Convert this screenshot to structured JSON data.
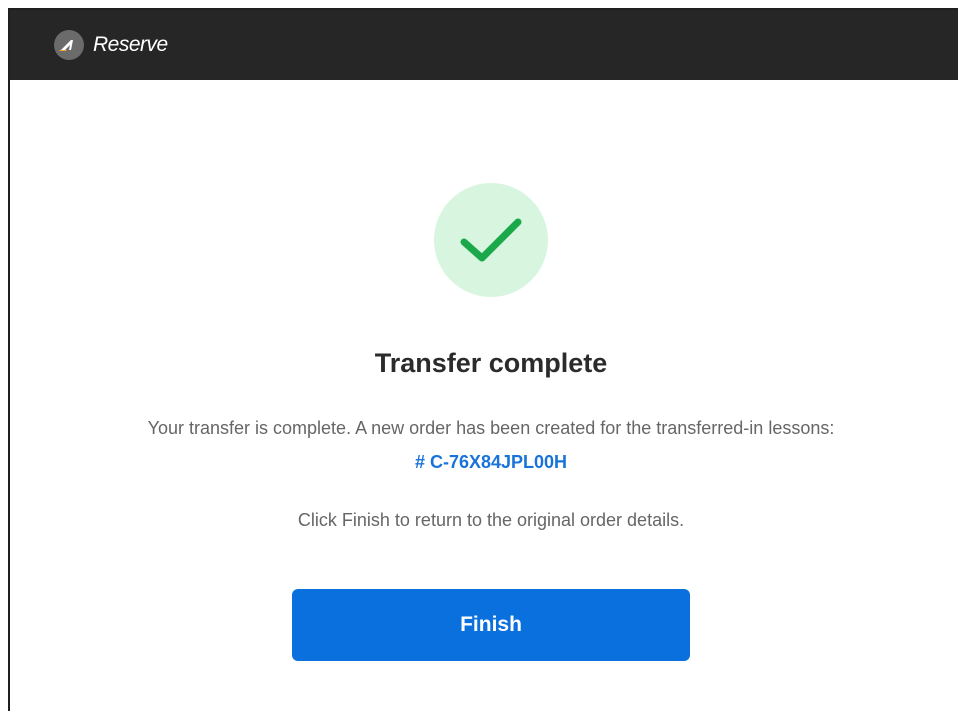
{
  "header": {
    "brand": "Reserve",
    "logo_icon": "active-logo-icon"
  },
  "success": {
    "icon": "checkmark-icon",
    "circle_color": "#d7f5df",
    "check_color": "#1aa84a",
    "title": "Transfer complete",
    "message": "Your transfer is complete. A new order has been created for the transferred-in lessons:",
    "order_number": "# C-76X84JPL00H",
    "instruction": "Click Finish to return to the original order details.",
    "finish_label": "Finish"
  },
  "colors": {
    "header_bg": "#262626",
    "primary": "#0a70dd",
    "link": "#1a73d9"
  }
}
